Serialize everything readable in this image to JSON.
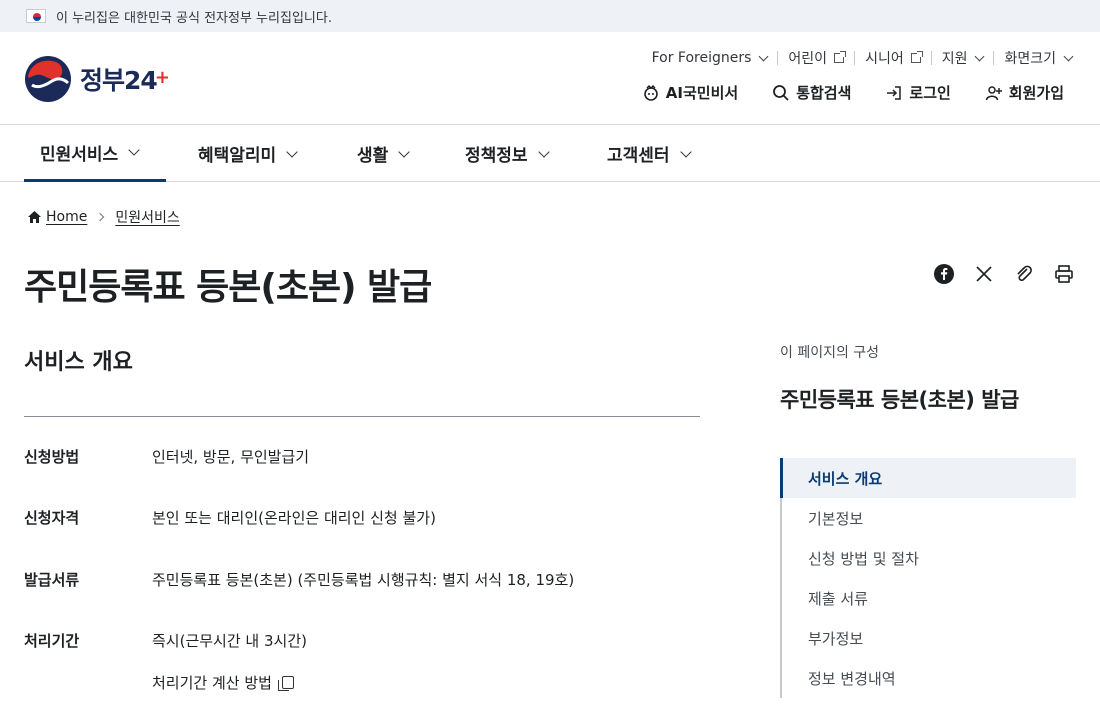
{
  "gov_banner": {
    "text": "이 누리집은 대한민국 공식 전자정부 누리집입니다."
  },
  "logo": {
    "text": "정부",
    "number": "24",
    "plus": "+"
  },
  "utility_links": [
    {
      "label": "For Foreigners",
      "icon": "chevron-down-icon"
    },
    {
      "label": "어린이",
      "icon": "external-link-icon"
    },
    {
      "label": "시니어",
      "icon": "external-link-icon"
    },
    {
      "label": "지원",
      "icon": "chevron-down-icon"
    },
    {
      "label": "화면크기",
      "icon": "chevron-down-icon"
    }
  ],
  "actions": [
    {
      "label": "AI국민비서",
      "icon": "ai-assistant-icon"
    },
    {
      "label": "통합검색",
      "icon": "search-icon"
    },
    {
      "label": "로그인",
      "icon": "login-icon"
    },
    {
      "label": "회원가입",
      "icon": "signup-icon"
    }
  ],
  "gnb": [
    {
      "label": "민원서비스",
      "active": true
    },
    {
      "label": "혜택알리미",
      "active": false
    },
    {
      "label": "생활",
      "active": false
    },
    {
      "label": "정책정보",
      "active": false
    },
    {
      "label": "고객센터",
      "active": false
    }
  ],
  "breadcrumb": {
    "home": "Home",
    "current": "민원서비스"
  },
  "page_title": "주민등록표 등본(초본) 발급",
  "share_icons": [
    "facebook-icon",
    "x-icon",
    "link-icon",
    "print-icon"
  ],
  "section_title": "서비스 개요",
  "info": [
    {
      "label": "신청방법",
      "value": "인터넷, 방문, 무인발급기"
    },
    {
      "label": "신청자격",
      "value": "본인 또는 대리인(온라인은 대리인 신청 불가)"
    },
    {
      "label": "발급서류",
      "value": "주민등록표 등본(초본) (주민등록법 시행규칙: 별지 서식 18, 19호)"
    },
    {
      "label": "처리기간",
      "value": "즉시(근무시간 내 3시간)"
    }
  ],
  "calc_link": "처리기간 계산 방법",
  "toc": {
    "caption": "이 페이지의 구성",
    "title": "주민등록표 등본(초본) 발급",
    "items": [
      {
        "label": "서비스 개요",
        "active": true
      },
      {
        "label": "기본정보",
        "active": false
      },
      {
        "label": "신청 방법 및 절차",
        "active": false
      },
      {
        "label": "제출 서류",
        "active": false
      },
      {
        "label": "부가정보",
        "active": false
      },
      {
        "label": "정보 변경내역",
        "active": false
      }
    ]
  },
  "colors": {
    "brand_navy": "#0b3b74",
    "banner_bg": "#eef1f6",
    "toc_active_bg": "#eef2f7"
  }
}
